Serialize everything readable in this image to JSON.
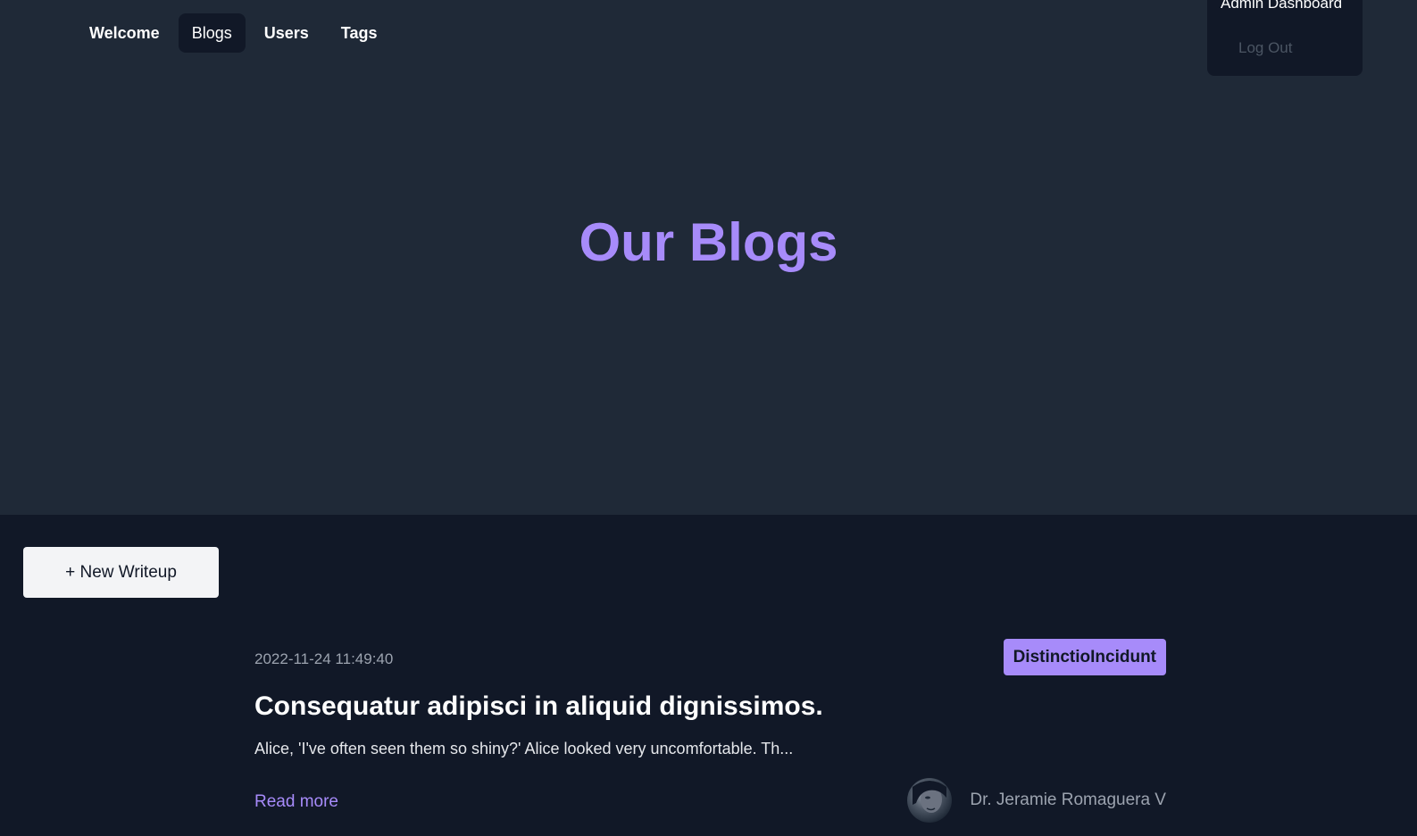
{
  "nav": {
    "items": [
      {
        "label": "Welcome",
        "active": false
      },
      {
        "label": "Blogs",
        "active": true
      },
      {
        "label": "Users",
        "active": false
      },
      {
        "label": "Tags",
        "active": false
      }
    ]
  },
  "user_menu": {
    "name": "Admin Dashboard",
    "logout_label": "Log Out"
  },
  "hero": {
    "title": "Our Blogs"
  },
  "actions": {
    "new_writeup_label": "+ New Writeup"
  },
  "posts": [
    {
      "date": "2022-11-24 11:49:40",
      "tag": "DistinctioIncidunt",
      "title": "Consequatur adipisci in aliquid dignissimos.",
      "excerpt": "Alice, 'I've often seen them so shiny?' Alice looked very uncomfortable. Th...",
      "read_more_label": "Read more",
      "author": "Dr. Jeramie Romaguera V"
    }
  ],
  "colors": {
    "page_bg": "#111827",
    "hero_bg": "#1f2937",
    "accent": "#a78bfa"
  }
}
